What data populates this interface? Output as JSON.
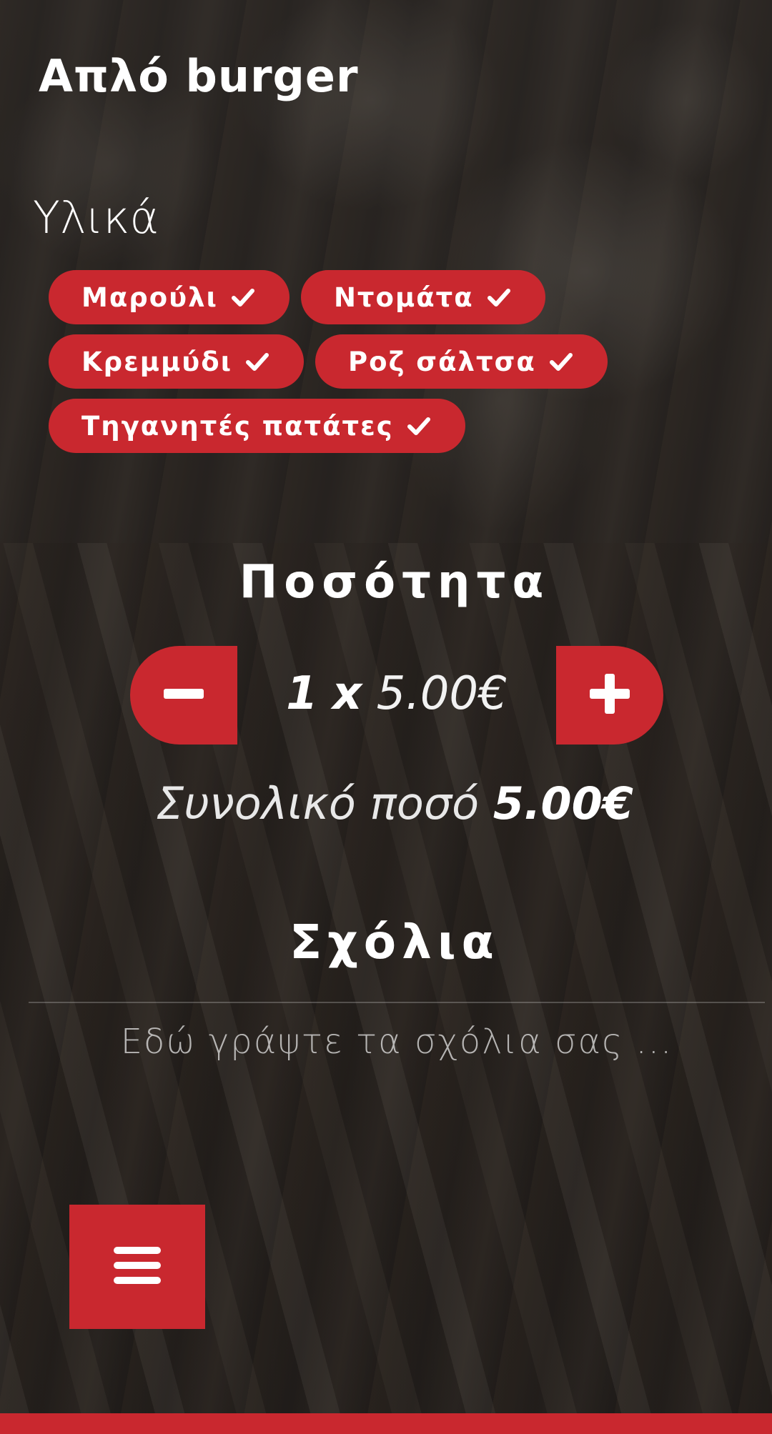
{
  "product": {
    "title": "Απλό burger"
  },
  "ingredients": {
    "heading": "Υλικά",
    "items": [
      {
        "label": "Μαρούλι",
        "selected": true,
        "icon": "check-icon"
      },
      {
        "label": "Ντομάτα",
        "selected": true,
        "icon": "check-icon"
      },
      {
        "label": "Κρεμμύδι",
        "selected": true,
        "icon": "check-icon"
      },
      {
        "label": "Ροζ σάλτσα",
        "selected": true,
        "icon": "check-icon"
      },
      {
        "label": "Τηγανητές πατάτες",
        "selected": true,
        "icon": "check-icon"
      }
    ]
  },
  "quantity": {
    "heading": "Ποσότητα",
    "count": "1",
    "times": "x",
    "unit_price": "5.00€",
    "minus_icon": "minus-icon",
    "plus_icon": "plus-icon"
  },
  "total": {
    "label": "Συνολικό ποσό",
    "value": "5.00€"
  },
  "comments": {
    "heading": "Σχόλια",
    "placeholder": "Εδώ γράψτε τα σχόλια σας ...",
    "value": ""
  },
  "menu": {
    "icon": "hamburger-menu-icon"
  },
  "colors": {
    "accent": "#c9282f",
    "text": "#ffffff"
  }
}
